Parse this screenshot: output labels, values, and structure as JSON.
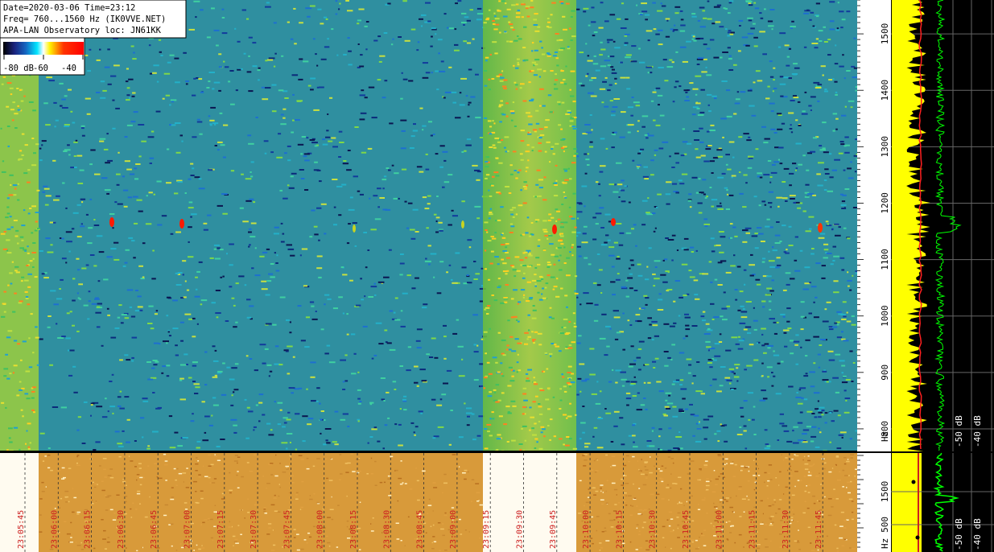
{
  "header": {
    "line1": "Date=2020-03-06 Time=23:12",
    "line2": "Freq= 760...1560 Hz (IK0VVE.NET)",
    "line3": "APA-LAN Observatory loc: JN61KK"
  },
  "colorbar": {
    "labels": [
      "-80 dB",
      "-60",
      "-40"
    ],
    "colors": [
      "#000000",
      "#1a237e",
      "#1565c0",
      "#00e5ff",
      "#ffffff",
      "#fff200",
      "#ff3300",
      "#ff0000"
    ]
  },
  "top_axis": {
    "hz_unit": "Hz",
    "ticks": [
      "800",
      "900",
      "1000",
      "1100",
      "1200",
      "1300",
      "1400",
      "1500"
    ]
  },
  "bottom_axis": {
    "hz_unit": "Hz",
    "ticks": [
      "500",
      "1500"
    ]
  },
  "right_panel": {
    "db_labels_top": [
      "-50 dB",
      "-40 dB"
    ],
    "db_labels_bottom": [
      "-50 dB",
      "-40 dB"
    ]
  },
  "time_labels": [
    "23:05:45",
    "23:06:00",
    "23:06:15",
    "23:06:30",
    "23:06:45",
    "23:07:00",
    "23:07:15",
    "23:07:30",
    "23:07:45",
    "23:08:00",
    "23:08:15",
    "23:08:30",
    "23:08:45",
    "23:09:00",
    "23:09:15",
    "23:09:30",
    "23:09:45",
    "23:10:00",
    "23:10:15",
    "23:10:30",
    "23:10:45",
    "23:11:00",
    "23:11:15",
    "23:11:30",
    "23:11:45"
  ],
  "colors": {
    "background_main": "#2f8fa0",
    "time_label": "#cc2020",
    "accent_green": "#00ff00",
    "accent_yellow": "#ffff00"
  }
}
